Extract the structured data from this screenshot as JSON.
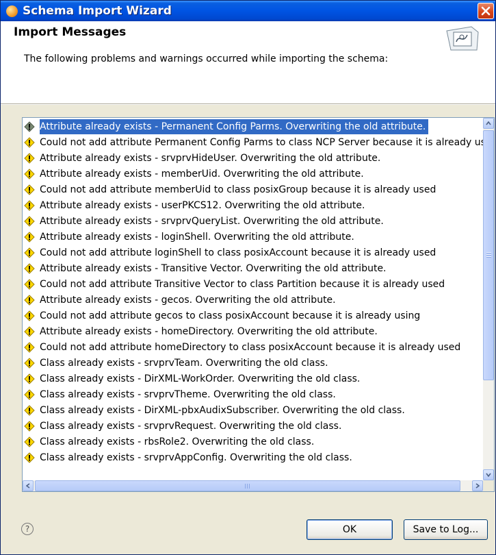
{
  "window": {
    "title": "Schema Import Wizard"
  },
  "header": {
    "title": "Import Messages",
    "description": "The following problems and warnings occurred while importing the schema:"
  },
  "messages": [
    {
      "text": "Attribute already exists - Permanent Config Parms.  Overwriting the old attribute.",
      "icon": "warning-icon",
      "selected": true
    },
    {
      "text": "Could not add attribute Permanent Config Parms to class NCP Server because it is already used",
      "icon": "warning-icon"
    },
    {
      "text": "Attribute already exists - srvprvHideUser.  Overwriting the old attribute.",
      "icon": "warning-icon"
    },
    {
      "text": "Attribute already exists - memberUid.  Overwriting the old attribute.",
      "icon": "warning-icon"
    },
    {
      "text": "Could not add attribute memberUid to class posixGroup because it is already used",
      "icon": "warning-icon"
    },
    {
      "text": "Attribute already exists - userPKCS12.  Overwriting the old attribute.",
      "icon": "warning-icon"
    },
    {
      "text": "Attribute already exists - srvprvQueryList.  Overwriting the old attribute.",
      "icon": "warning-icon"
    },
    {
      "text": "Attribute already exists - loginShell.  Overwriting the old attribute.",
      "icon": "warning-icon"
    },
    {
      "text": "Could not add attribute loginShell to class posixAccount because it is already used",
      "icon": "warning-icon"
    },
    {
      "text": "Attribute already exists - Transitive Vector.  Overwriting the old attribute.",
      "icon": "warning-icon"
    },
    {
      "text": "Could not add attribute Transitive Vector to class Partition because it is already used",
      "icon": "warning-icon"
    },
    {
      "text": "Attribute already exists - gecos.  Overwriting the old attribute.",
      "icon": "warning-icon"
    },
    {
      "text": "Could not add attribute gecos to class posixAccount because it is already using",
      "icon": "warning-icon"
    },
    {
      "text": "Attribute already exists - homeDirectory.  Overwriting the old attribute.",
      "icon": "warning-icon"
    },
    {
      "text": "Could not add attribute homeDirectory to class posixAccount because it is already used",
      "icon": "warning-icon"
    },
    {
      "text": "Class already exists - srvprvTeam.  Overwriting the old class.",
      "icon": "warning-icon"
    },
    {
      "text": "Class already exists - DirXML-WorkOrder.  Overwriting the old class.",
      "icon": "warning-icon"
    },
    {
      "text": "Class already exists - srvprvTheme.  Overwriting the old class.",
      "icon": "warning-icon"
    },
    {
      "text": "Class already exists - DirXML-pbxAudixSubscriber.  Overwriting the old class.",
      "icon": "warning-icon"
    },
    {
      "text": "Class already exists - srvprvRequest.  Overwriting the old class.",
      "icon": "warning-icon"
    },
    {
      "text": "Class already exists - rbsRole2.  Overwriting the old class.",
      "icon": "warning-icon"
    },
    {
      "text": "Class already exists - srvprvAppConfig.  Overwriting the old class.",
      "icon": "warning-icon"
    }
  ],
  "buttons": {
    "ok": "OK",
    "save_to_log": "Save to Log..."
  },
  "colors": {
    "title_bar": "#0054e3",
    "selection": "#316ac5",
    "warning": "#ffd800"
  }
}
